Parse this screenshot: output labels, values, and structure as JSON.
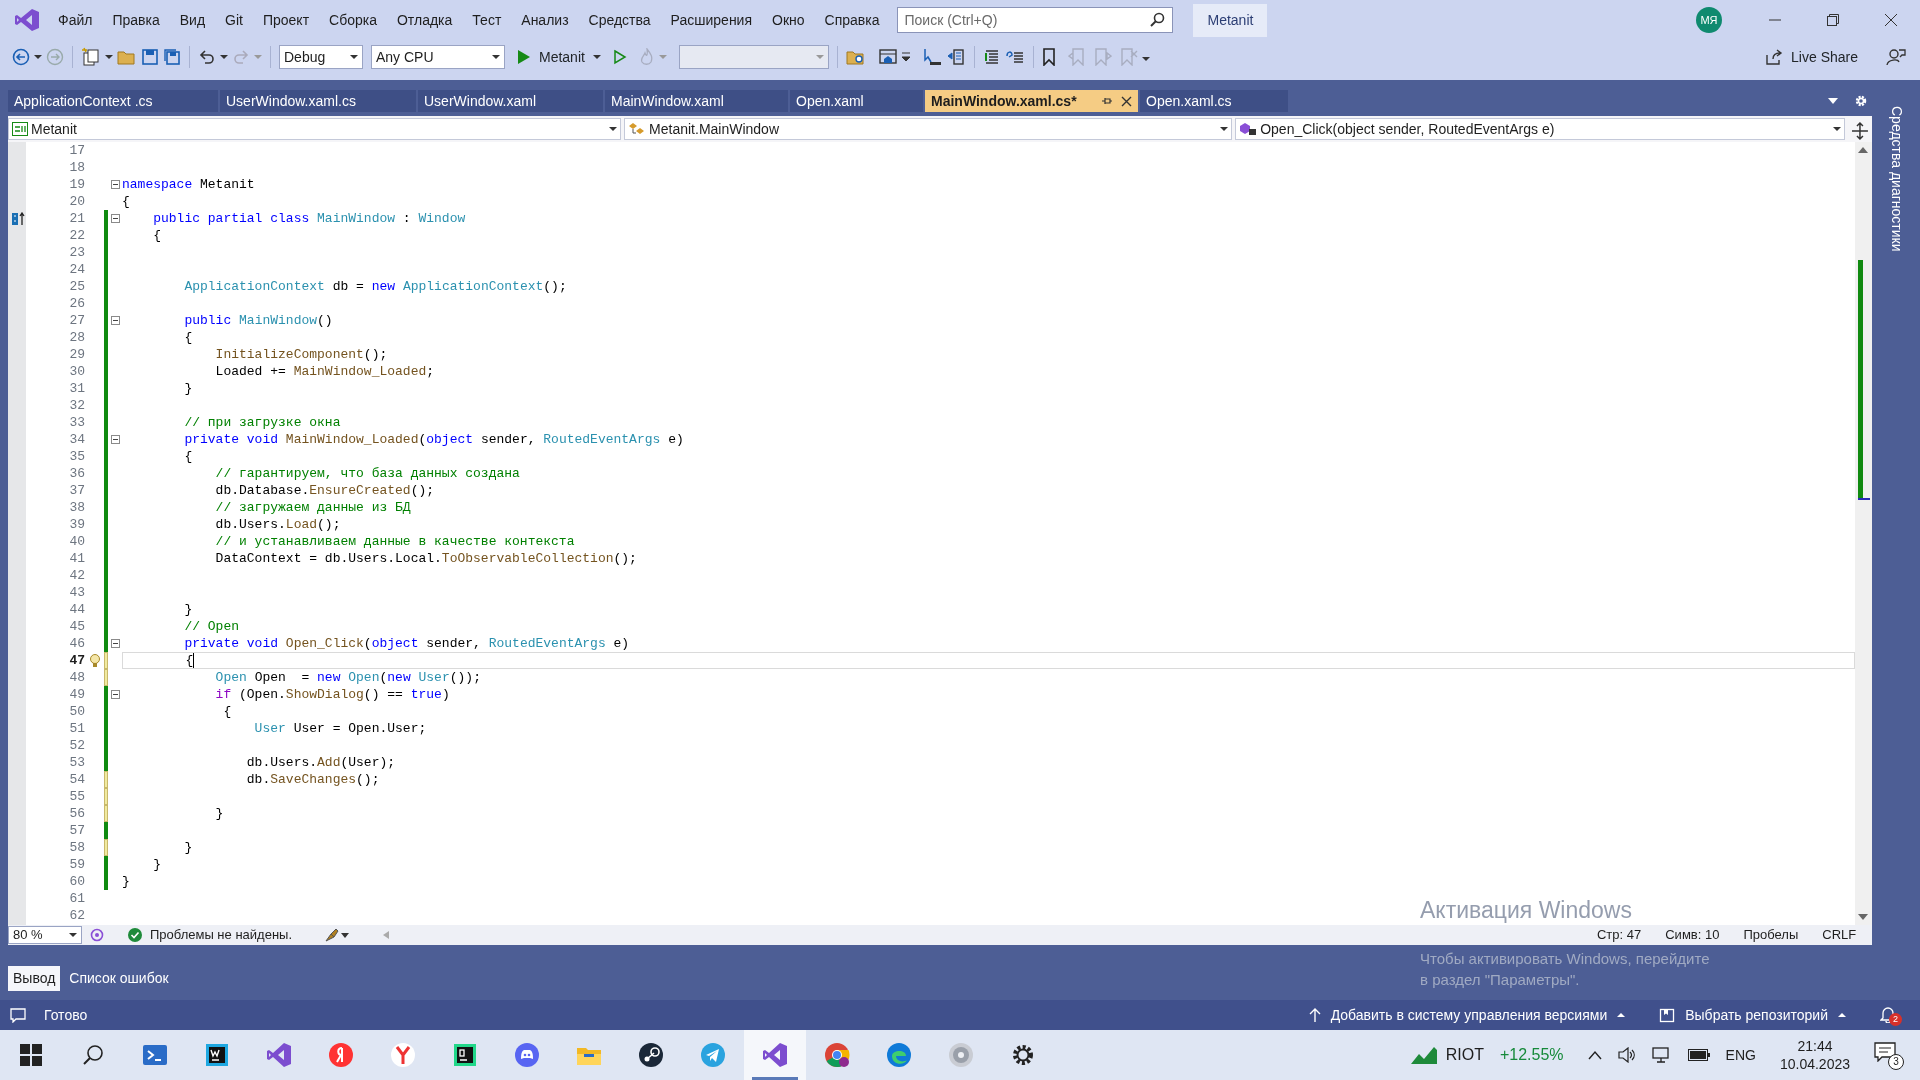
{
  "menu": [
    "Файл",
    "Правка",
    "Вид",
    "Git",
    "Проект",
    "Сборка",
    "Отладка",
    "Тест",
    "Анализ",
    "Средства",
    "Расширения",
    "Окно",
    "Справка"
  ],
  "search": {
    "placeholder": "Поиск (Ctrl+Q)"
  },
  "solution_badge": "Metanit",
  "account": "МЯ",
  "toolbar": {
    "configuration": "Debug",
    "platform": "Any CPU",
    "start": "Metanit",
    "live_share": "Live Share"
  },
  "tabs": [
    {
      "label": "ApplicationContext .cs",
      "selected": false
    },
    {
      "label": "UserWindow.xaml.cs",
      "selected": false
    },
    {
      "label": "UserWindow.xaml",
      "selected": false
    },
    {
      "label": "MainWindow.xaml",
      "selected": false
    },
    {
      "label": "Open.xaml",
      "selected": false
    },
    {
      "label": "MainWindow.xaml.cs*",
      "selected": true
    },
    {
      "label": "Open.xaml.cs",
      "selected": false
    }
  ],
  "nav": {
    "project": "Metanit",
    "type": "Metanit.MainWindow",
    "member": "Open_Click(object sender, RoutedEventArgs e)"
  },
  "side_tab": "Средства диагностики",
  "code": {
    "lines": [
      {
        "number": "17",
        "modified": false
      },
      {
        "number": "18",
        "modified": false
      },
      {
        "number": "19",
        "modified": false,
        "fold": true,
        "tokens": [
          {
            "kind": "keyword",
            "text": "namespace"
          },
          {
            "kind": "plain",
            "text": " Metanit"
          }
        ]
      },
      {
        "number": "20",
        "modified": false,
        "tokens": [
          {
            "kind": "plain",
            "text": "{"
          }
        ]
      },
      {
        "number": "21",
        "modified": true,
        "saved": true,
        "fold": true,
        "override": true,
        "tokens": [
          {
            "kind": "keyword",
            "text": "    public partial class "
          },
          {
            "kind": "type",
            "text": "MainWindow"
          },
          {
            "kind": "plain",
            "text": " : "
          },
          {
            "kind": "type",
            "text": "Window"
          }
        ]
      },
      {
        "number": "22",
        "modified": true,
        "saved": true,
        "tokens": [
          {
            "kind": "plain",
            "text": "    {"
          }
        ]
      },
      {
        "number": "23",
        "modified": true,
        "saved": true
      },
      {
        "number": "24",
        "modified": true,
        "saved": true
      },
      {
        "number": "25",
        "modified": true,
        "saved": true,
        "tokens": [
          {
            "kind": "type",
            "text": "        ApplicationContext"
          },
          {
            "kind": "plain",
            "text": " db = "
          },
          {
            "kind": "keyword",
            "text": "new "
          },
          {
            "kind": "type",
            "text": "ApplicationContext"
          },
          {
            "kind": "plain",
            "text": "();"
          }
        ]
      },
      {
        "number": "26",
        "modified": true,
        "saved": true
      },
      {
        "number": "27",
        "modified": true,
        "saved": true,
        "fold": true,
        "tokens": [
          {
            "kind": "keyword",
            "text": "        public "
          },
          {
            "kind": "type",
            "text": "MainWindow"
          },
          {
            "kind": "plain",
            "text": "()"
          }
        ]
      },
      {
        "number": "28",
        "modified": true,
        "saved": true,
        "tokens": [
          {
            "kind": "plain",
            "text": "        {"
          }
        ]
      },
      {
        "number": "29",
        "modified": true,
        "saved": true,
        "tokens": [
          {
            "kind": "method",
            "text": "            InitializeComponent"
          },
          {
            "kind": "plain",
            "text": "();"
          }
        ]
      },
      {
        "number": "30",
        "modified": true,
        "saved": true,
        "tokens": [
          {
            "kind": "plain",
            "text": "            Loaded += "
          },
          {
            "kind": "method",
            "text": "MainWindow_Loaded"
          },
          {
            "kind": "plain",
            "text": ";"
          }
        ]
      },
      {
        "number": "31",
        "modified": true,
        "saved": true,
        "tokens": [
          {
            "kind": "plain",
            "text": "        }"
          }
        ]
      },
      {
        "number": "32",
        "modified": true,
        "saved": true
      },
      {
        "number": "33",
        "modified": true,
        "saved": true,
        "tokens": [
          {
            "kind": "comment",
            "text": "        // при загрузке окна"
          }
        ]
      },
      {
        "number": "34",
        "modified": true,
        "saved": true,
        "fold": true,
        "tokens": [
          {
            "kind": "keyword",
            "text": "        private void "
          },
          {
            "kind": "method",
            "text": "MainWindow_Loaded"
          },
          {
            "kind": "plain",
            "text": "("
          },
          {
            "kind": "keyword",
            "text": "object"
          },
          {
            "kind": "plain",
            "text": " sender, "
          },
          {
            "kind": "type",
            "text": "RoutedEventArgs"
          },
          {
            "kind": "plain",
            "text": " e)"
          }
        ]
      },
      {
        "number": "35",
        "modified": true,
        "saved": true,
        "tokens": [
          {
            "kind": "plain",
            "text": "        {"
          }
        ]
      },
      {
        "number": "36",
        "modified": true,
        "saved": true,
        "tokens": [
          {
            "kind": "comment",
            "text": "            // гарантируем, что база данных создана"
          }
        ]
      },
      {
        "number": "37",
        "modified": true,
        "saved": true,
        "tokens": [
          {
            "kind": "plain",
            "text": "            db.Database."
          },
          {
            "kind": "method",
            "text": "EnsureCreated"
          },
          {
            "kind": "plain",
            "text": "();"
          }
        ]
      },
      {
        "number": "38",
        "modified": true,
        "saved": true,
        "tokens": [
          {
            "kind": "comment",
            "text": "            // загружаем данные из БД"
          }
        ]
      },
      {
        "number": "39",
        "modified": true,
        "saved": true,
        "tokens": [
          {
            "kind": "plain",
            "text": "            db.Users."
          },
          {
            "kind": "method",
            "text": "Load"
          },
          {
            "kind": "plain",
            "text": "();"
          }
        ]
      },
      {
        "number": "40",
        "modified": true,
        "saved": true,
        "tokens": [
          {
            "kind": "comment",
            "text": "            // и устанавливаем данные в качестве контекста"
          }
        ]
      },
      {
        "number": "41",
        "modified": true,
        "saved": true,
        "tokens": [
          {
            "kind": "plain",
            "text": "            DataContext = db.Users.Local."
          },
          {
            "kind": "method",
            "text": "ToObservableCollection"
          },
          {
            "kind": "plain",
            "text": "();"
          }
        ]
      },
      {
        "number": "42",
        "modified": true,
        "saved": true
      },
      {
        "number": "43",
        "modified": true,
        "saved": true
      },
      {
        "number": "44",
        "modified": true,
        "saved": true,
        "tokens": [
          {
            "kind": "plain",
            "text": "        }"
          }
        ]
      },
      {
        "number": "45",
        "modified": true,
        "saved": true,
        "tokens": [
          {
            "kind": "comment",
            "text": "        // Open"
          }
        ]
      },
      {
        "number": "46",
        "modified": true,
        "saved": true,
        "fold": true,
        "tokens": [
          {
            "kind": "keyword",
            "text": "        private void "
          },
          {
            "kind": "method",
            "text": "Open_Click"
          },
          {
            "kind": "plain",
            "text": "("
          },
          {
            "kind": "keyword",
            "text": "object"
          },
          {
            "kind": "plain",
            "text": " sender, "
          },
          {
            "kind": "type",
            "text": "RoutedEventArgs"
          },
          {
            "kind": "plain",
            "text": " e)"
          }
        ]
      },
      {
        "number": "47",
        "modified": true,
        "saved": false,
        "current": true,
        "tokens": [
          {
            "kind": "plain",
            "text": "        {"
          }
        ]
      },
      {
        "number": "48",
        "modified": true,
        "saved": false,
        "tokens": [
          {
            "kind": "type",
            "text": "            Open"
          },
          {
            "kind": "plain",
            "text": " Open  = "
          },
          {
            "kind": "keyword",
            "text": "new "
          },
          {
            "kind": "type",
            "text": "Open"
          },
          {
            "kind": "plain",
            "text": "("
          },
          {
            "kind": "keyword",
            "text": "new "
          },
          {
            "kind": "type",
            "text": "User"
          },
          {
            "kind": "plain",
            "text": "());"
          }
        ]
      },
      {
        "number": "49",
        "modified": true,
        "saved": true,
        "fold": true,
        "tokens": [
          {
            "kind": "control",
            "text": "            if"
          },
          {
            "kind": "plain",
            "text": " (Open."
          },
          {
            "kind": "method",
            "text": "ShowDialog"
          },
          {
            "kind": "plain",
            "text": "() == "
          },
          {
            "kind": "keyword",
            "text": "true"
          },
          {
            "kind": "plain",
            "text": ")"
          }
        ]
      },
      {
        "number": "50",
        "modified": true,
        "saved": true,
        "tokens": [
          {
            "kind": "plain",
            "text": "             {"
          }
        ]
      },
      {
        "number": "51",
        "modified": true,
        "saved": true,
        "tokens": [
          {
            "kind": "type",
            "text": "                 User"
          },
          {
            "kind": "plain",
            "text": " User = Open.User;"
          }
        ]
      },
      {
        "number": "52",
        "modified": true,
        "saved": true
      },
      {
        "number": "53",
        "modified": true,
        "saved": true,
        "tokens": [
          {
            "kind": "plain",
            "text": "                db.Users."
          },
          {
            "kind": "method",
            "text": "Add"
          },
          {
            "kind": "plain",
            "text": "(User);"
          }
        ]
      },
      {
        "number": "54",
        "modified": true,
        "saved": false,
        "tokens": [
          {
            "kind": "plain",
            "text": "                db."
          },
          {
            "kind": "method",
            "text": "SaveChanges"
          },
          {
            "kind": "plain",
            "text": "();"
          }
        ]
      },
      {
        "number": "55",
        "modified": true,
        "saved": false
      },
      {
        "number": "56",
        "modified": true,
        "saved": false,
        "tokens": [
          {
            "kind": "plain",
            "text": "            }"
          }
        ]
      },
      {
        "number": "57",
        "modified": true,
        "saved": true
      },
      {
        "number": "58",
        "modified": true,
        "saved": false,
        "tokens": [
          {
            "kind": "plain",
            "text": "        }"
          }
        ]
      },
      {
        "number": "59",
        "modified": true,
        "saved": true,
        "tokens": [
          {
            "kind": "plain",
            "text": "    }"
          }
        ]
      },
      {
        "number": "60",
        "modified": true,
        "saved": true,
        "tokens": [
          {
            "kind": "plain",
            "text": "}"
          }
        ]
      },
      {
        "number": "61",
        "modified": false
      },
      {
        "number": "62",
        "modified": false
      }
    ]
  },
  "editor_status": {
    "zoom": "80 %",
    "problems": "Проблемы не найдены.",
    "line": "Стр: 47",
    "column": "Симв: 10",
    "whitespace": "Пробелы",
    "line_endings": "CRLF"
  },
  "activation": {
    "title": "Активация Windows",
    "text": "Чтобы активировать Windows, перейдите в раздел \"Параметры\"."
  },
  "bottom_tabs": [
    {
      "label": "Вывод",
      "selected": true
    },
    {
      "label": "Список ошибок",
      "selected": false
    }
  ],
  "status_bar": {
    "text": "Готово",
    "source_control": "Добавить в систему управления версиями",
    "repository": "Выбрать репозиторий",
    "notifications": "2"
  },
  "taskbar": {
    "apps": [
      {
        "kind": "terminal",
        "active": false
      },
      {
        "kind": "webstorm",
        "active": false
      },
      {
        "kind": "visualstudio",
        "active": false
      },
      {
        "kind": "yandex",
        "active": false
      },
      {
        "kind": "ybrowser",
        "active": false
      },
      {
        "kind": "pycharm",
        "active": false
      },
      {
        "kind": "discord",
        "active": false
      },
      {
        "kind": "explorer",
        "active": false
      },
      {
        "kind": "steam",
        "active": false
      },
      {
        "kind": "telegram",
        "active": false
      },
      {
        "kind": "visualstudio",
        "active": true
      },
      {
        "kind": "chrome",
        "active": false
      },
      {
        "kind": "edge",
        "active": false
      },
      {
        "kind": "disc",
        "active": false
      },
      {
        "kind": "settings",
        "active": false
      }
    ],
    "stock": {
      "name": "RIOT",
      "change": "+12.55%"
    },
    "language": "ENG",
    "time": "21:44",
    "date": "10.04.2023",
    "notifications": "3"
  }
}
